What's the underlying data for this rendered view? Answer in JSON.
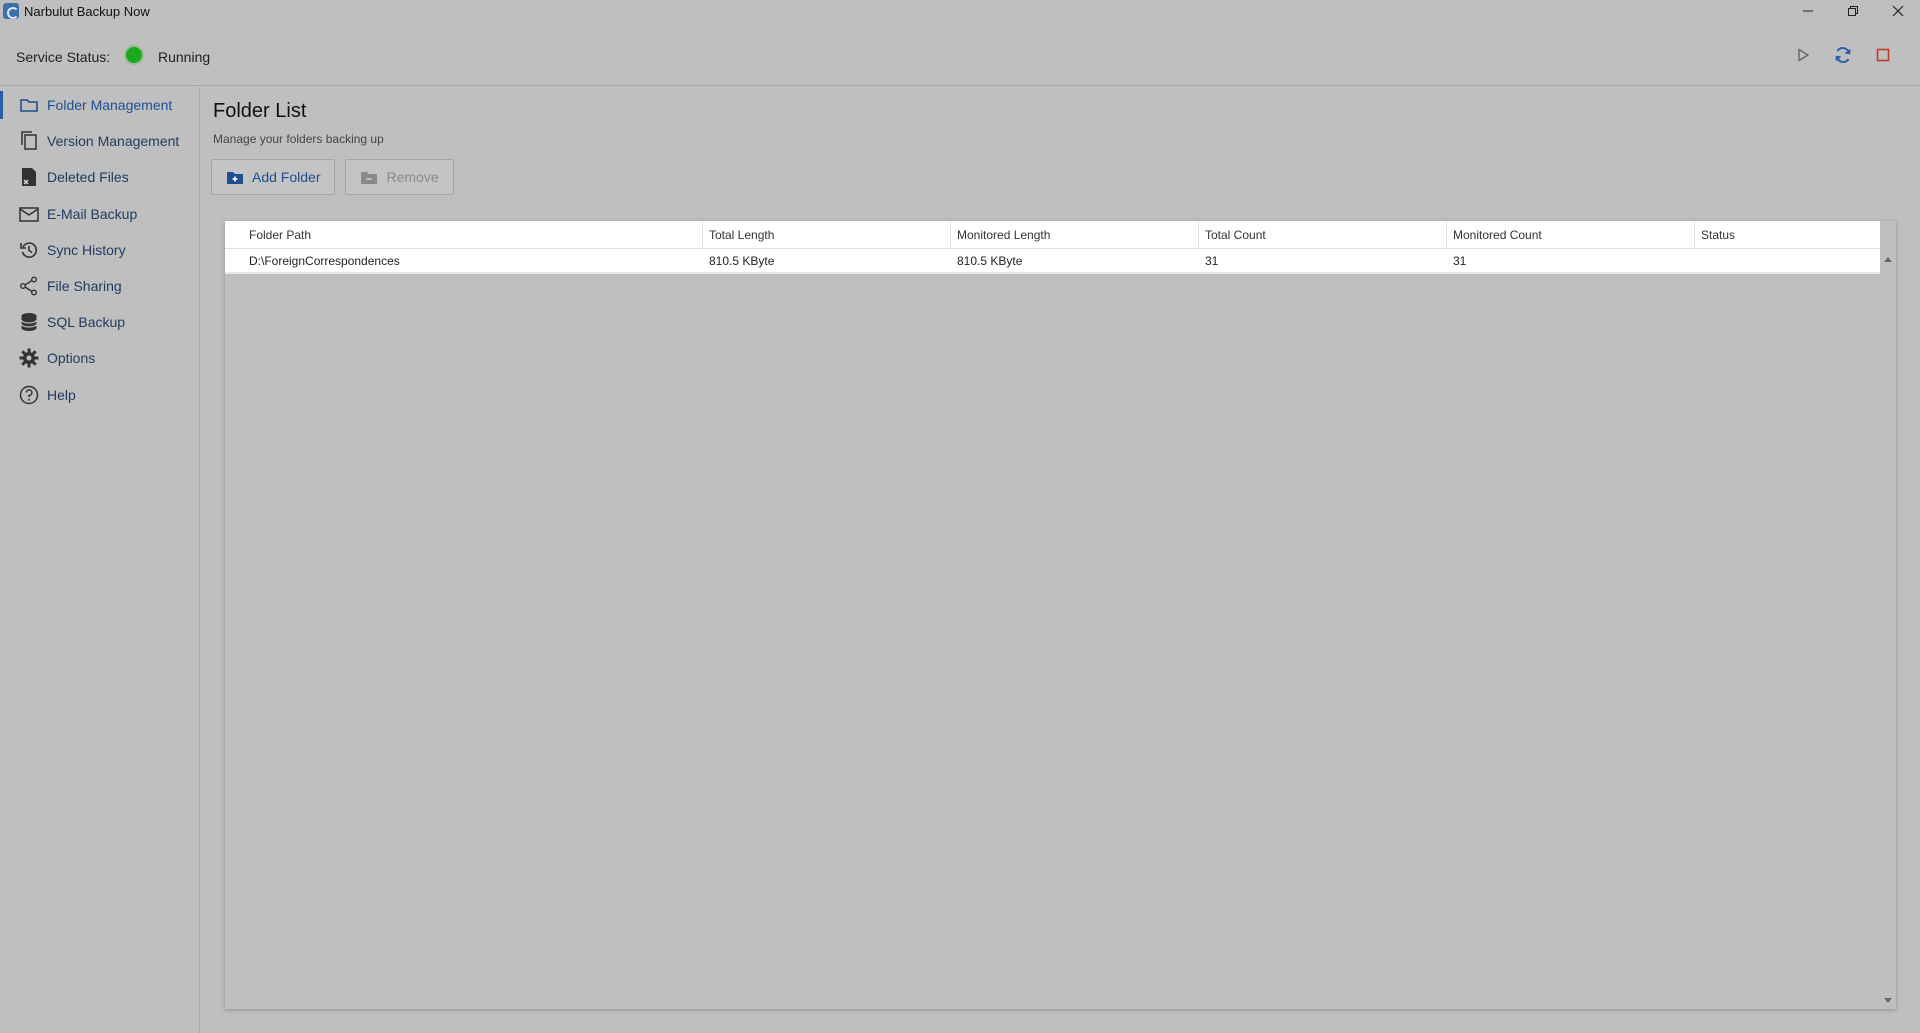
{
  "window": {
    "title": "Narbulut Backup Now",
    "controls": [
      "minimize",
      "restore",
      "close"
    ]
  },
  "header": {
    "status_label": "Service Status:",
    "status_value": "Running",
    "status_color": "#1ea81e",
    "actions": [
      {
        "name": "start",
        "icon": "play-icon"
      },
      {
        "name": "sync",
        "icon": "sync-icon",
        "color": "#2a5fa8"
      },
      {
        "name": "stop",
        "icon": "stop-icon",
        "color": "#c0392b"
      }
    ]
  },
  "sidebar": {
    "items": [
      {
        "label": "Folder Management",
        "icon": "folder-icon",
        "active": true
      },
      {
        "label": "Version Management",
        "icon": "versions-icon",
        "active": false
      },
      {
        "label": "Deleted Files",
        "icon": "deleted-file-icon",
        "active": false
      },
      {
        "label": "E-Mail Backup",
        "icon": "mail-icon",
        "active": false
      },
      {
        "label": "Sync History",
        "icon": "history-icon",
        "active": false
      },
      {
        "label": "File Sharing",
        "icon": "share-icon",
        "active": false
      },
      {
        "label": "SQL Backup",
        "icon": "database-icon",
        "active": false
      },
      {
        "label": "Options",
        "icon": "gear-icon",
        "active": false
      },
      {
        "label": "Help",
        "icon": "help-icon",
        "active": false
      }
    ]
  },
  "main": {
    "title": "Folder List",
    "subtitle": "Manage your folders backing up",
    "toolbar": {
      "add_label": "Add Folder",
      "remove_label": "Remove"
    },
    "table": {
      "columns": [
        "Folder Path",
        "Total Length",
        "Monitored Length",
        "Total Count",
        "Monitored Count",
        "Status"
      ],
      "rows": [
        [
          "D:\\ForeignCorrespondences",
          "810.5 KByte",
          "810.5 KByte",
          "31",
          "31",
          ""
        ]
      ]
    }
  },
  "colors": {
    "accent": "#1d4f91",
    "background": "#bfbfbf"
  }
}
